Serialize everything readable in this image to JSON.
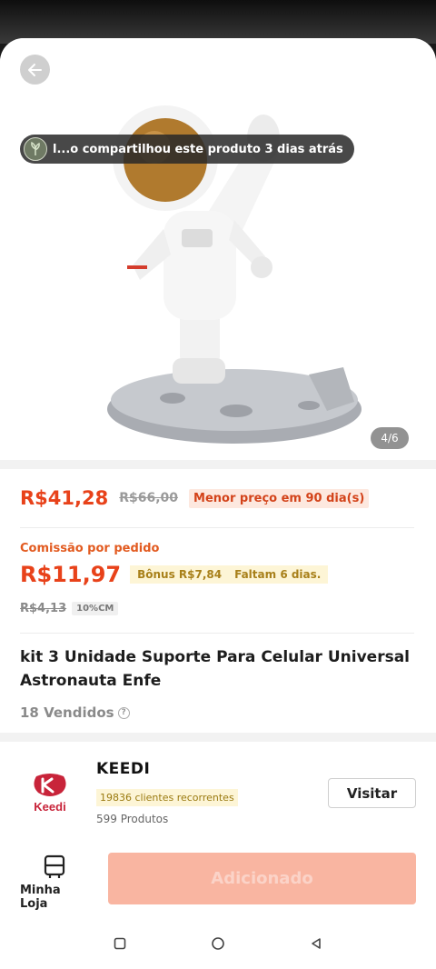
{
  "gallery": {
    "share_text": "l...o compartilhou este produto 3 dias atrás",
    "counter": "4/6"
  },
  "pricing": {
    "price": "R$41,28",
    "original_price": "R$66,00",
    "lowest_tag": "Menor preço em 90 dia(s)",
    "commission_label": "Comissão por pedido",
    "commission_value": "R$11,97",
    "bonus_text": "Bônus R$7,84",
    "days_left": "Faltam 6 dias.",
    "commission_old": "R$4,13",
    "commission_rate": "10%CM"
  },
  "product": {
    "title": "kit 3 Unidade Suporte Para Celular Universal Astronauta Enfe",
    "sold": "18 Vendidos"
  },
  "store": {
    "logo_text": "Keedi",
    "name": "KEEDI",
    "repeat_customers": "19836 clientes recorrentes",
    "product_count": "599 Produtos",
    "visit_label": "Visitar"
  },
  "bottom": {
    "my_shop_label": "Minha Loja",
    "add_label": "Adicionado"
  },
  "colors": {
    "accent": "#e8421a",
    "add_button": "#f9b5a1",
    "bonus_bg": "#fdf5d6"
  }
}
